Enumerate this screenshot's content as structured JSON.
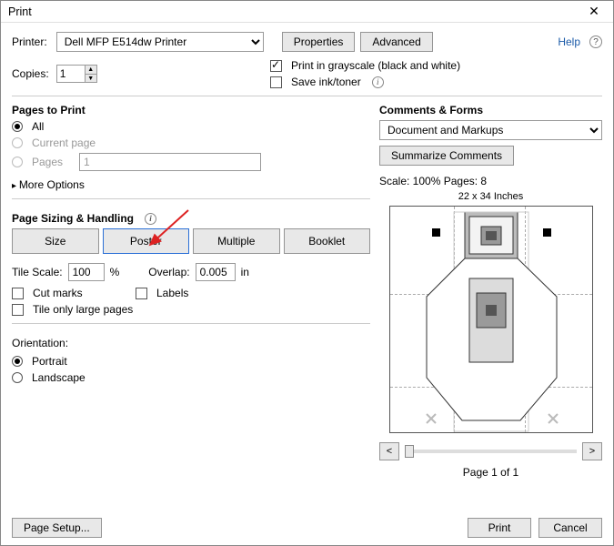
{
  "window": {
    "title": "Print"
  },
  "header": {
    "printer_label": "Printer:",
    "printer_value": "Dell MFP E514dw Printer",
    "properties": "Properties",
    "advanced": "Advanced",
    "help": "Help",
    "copies_label": "Copies:",
    "copies_value": "1",
    "grayscale": "Print in grayscale (black and white)",
    "save_ink": "Save ink/toner"
  },
  "pages": {
    "title": "Pages to Print",
    "all": "All",
    "current": "Current page",
    "pages_label": "Pages",
    "pages_value": "1",
    "more": "More Options"
  },
  "sizing": {
    "title": "Page Sizing & Handling",
    "size": "Size",
    "poster": "Poster",
    "multiple": "Multiple",
    "booklet": "Booklet",
    "tile_scale_label": "Tile Scale:",
    "tile_scale_value": "100",
    "percent": "%",
    "overlap_label": "Overlap:",
    "overlap_value": "0.005",
    "overlap_unit": "in",
    "cut_marks": "Cut marks",
    "labels": "Labels",
    "tile_large": "Tile only large pages"
  },
  "orientation": {
    "title": "Orientation:",
    "portrait": "Portrait",
    "landscape": "Landscape"
  },
  "preview": {
    "title": "Comments & Forms",
    "dropdown": "Document and Markups",
    "summarize": "Summarize Comments",
    "scale": "Scale: 100% Pages: 8",
    "dims": "22 x 34 Inches",
    "page_of": "Page 1 of 1"
  },
  "footer": {
    "page_setup": "Page Setup...",
    "print": "Print",
    "cancel": "Cancel"
  }
}
